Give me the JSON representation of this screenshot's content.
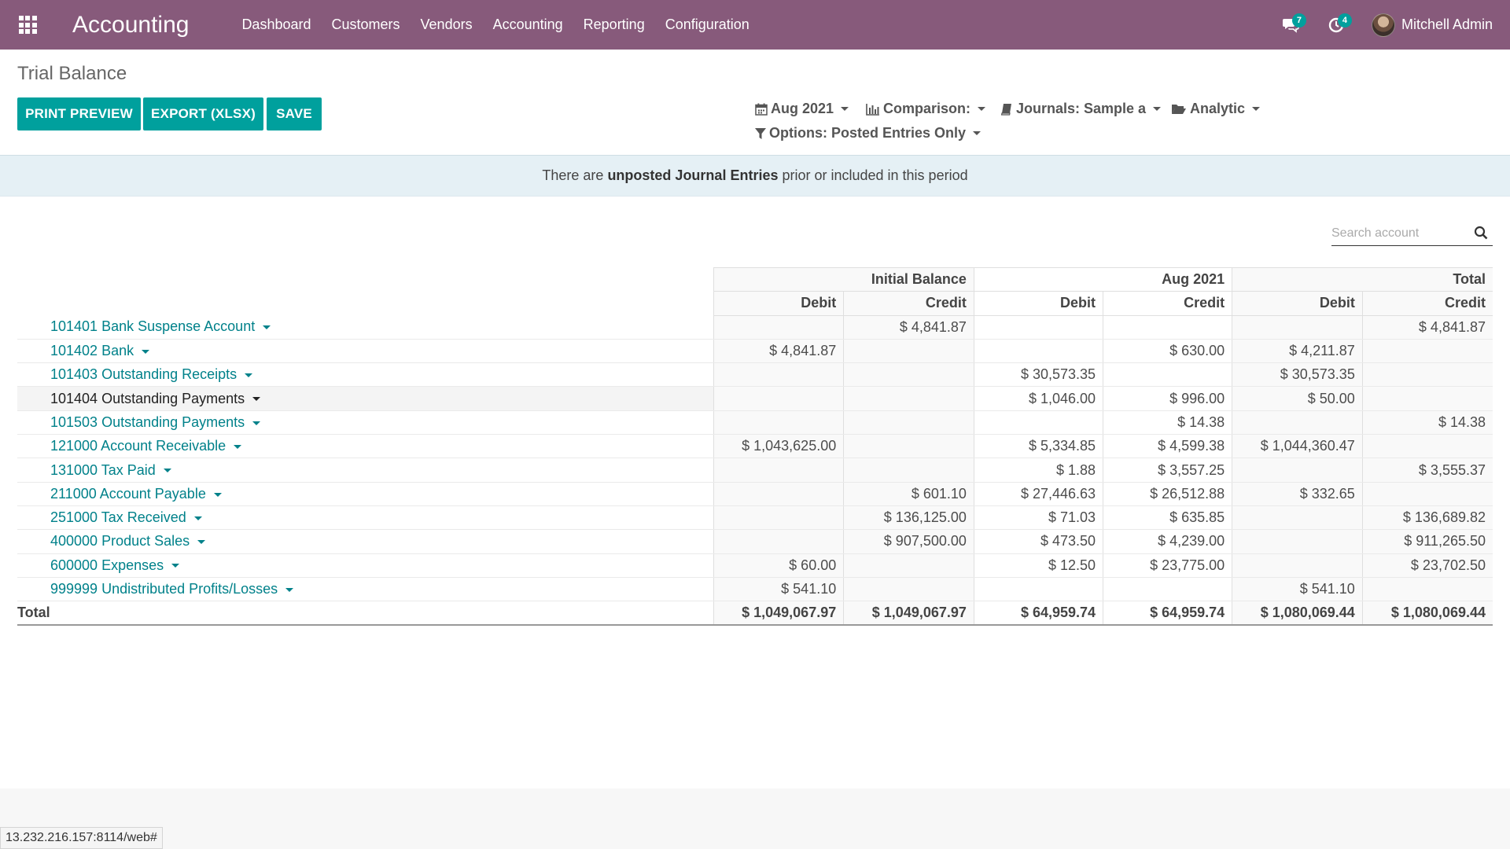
{
  "navbar": {
    "brand": "Accounting",
    "menu": [
      "Dashboard",
      "Customers",
      "Vendors",
      "Accounting",
      "Reporting",
      "Configuration"
    ],
    "messages_count": "7",
    "activities_count": "4",
    "user_name": "Mitchell Admin"
  },
  "page": {
    "title": "Trial Balance",
    "buttons": {
      "print": "PRINT PREVIEW",
      "export": "EXPORT (XLSX)",
      "save": "SAVE"
    },
    "filters": {
      "date": "Aug 2021",
      "comparison": "Comparison:",
      "journals": "Journals: Sample a",
      "analytic": "Analytic",
      "options": "Options: Posted Entries Only"
    }
  },
  "banner": {
    "prefix": "There are ",
    "bold": "unposted Journal Entries",
    "suffix": " prior or included in this period"
  },
  "search": {
    "placeholder": "Search account"
  },
  "table": {
    "groups": [
      "Initial Balance",
      "Aug 2021",
      "Total"
    ],
    "sub_headers": [
      "Debit",
      "Credit",
      "Debit",
      "Credit",
      "Debit",
      "Credit"
    ],
    "rows": [
      {
        "name": "101401 Bank Suspense Account",
        "vals": [
          "",
          "$ 4,841.87",
          "",
          "",
          "",
          "$ 4,841.87"
        ]
      },
      {
        "name": "101402 Bank",
        "vals": [
          "$ 4,841.87",
          "",
          "",
          "$ 630.00",
          "$ 4,211.87",
          ""
        ]
      },
      {
        "name": "101403 Outstanding Receipts",
        "vals": [
          "",
          "",
          "$ 30,573.35",
          "",
          "$ 30,573.35",
          ""
        ]
      },
      {
        "name": "101404 Outstanding Payments",
        "vals": [
          "",
          "",
          "$ 1,046.00",
          "$ 996.00",
          "$ 50.00",
          ""
        ]
      },
      {
        "name": "101503 Outstanding Payments",
        "vals": [
          "",
          "",
          "",
          "$ 14.38",
          "",
          "$ 14.38"
        ]
      },
      {
        "name": "121000 Account Receivable",
        "vals": [
          "$ 1,043,625.00",
          "",
          "$ 5,334.85",
          "$ 4,599.38",
          "$ 1,044,360.47",
          ""
        ]
      },
      {
        "name": "131000 Tax Paid",
        "vals": [
          "",
          "",
          "$ 1.88",
          "$ 3,557.25",
          "",
          "$ 3,555.37"
        ]
      },
      {
        "name": "211000 Account Payable",
        "vals": [
          "",
          "$ 601.10",
          "$ 27,446.63",
          "$ 26,512.88",
          "$ 332.65",
          ""
        ]
      },
      {
        "name": "251000 Tax Received",
        "vals": [
          "",
          "$ 136,125.00",
          "$ 71.03",
          "$ 635.85",
          "",
          "$ 136,689.82"
        ]
      },
      {
        "name": "400000 Product Sales",
        "vals": [
          "",
          "$ 907,500.00",
          "$ 473.50",
          "$ 4,239.00",
          "",
          "$ 911,265.50"
        ]
      },
      {
        "name": "600000 Expenses",
        "vals": [
          "$ 60.00",
          "",
          "$ 12.50",
          "$ 23,775.00",
          "",
          "$ 23,702.50"
        ]
      },
      {
        "name": "999999 Undistributed Profits/Losses",
        "vals": [
          "$ 541.10",
          "",
          "",
          "",
          "$ 541.10",
          ""
        ]
      }
    ],
    "total": {
      "label": "Total",
      "vals": [
        "$ 1,049,067.97",
        "$ 1,049,067.97",
        "$ 64,959.74",
        "$ 64,959.74",
        "$ 1,080,069.44",
        "$ 1,080,069.44"
      ]
    }
  },
  "statusbar": "13.232.216.157:8114/web#"
}
